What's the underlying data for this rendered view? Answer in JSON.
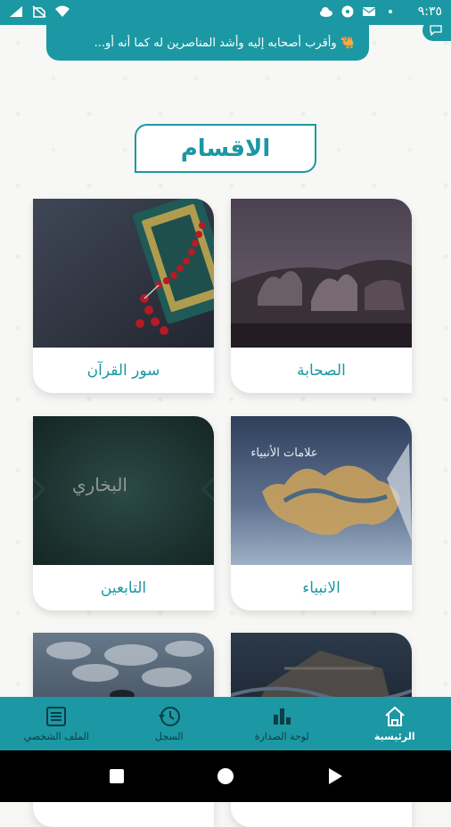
{
  "status_bar": {
    "time": "٩:٣٥"
  },
  "marquee": {
    "text": "🐫 وأقرب أصحابه إليه وأشد المناصرين له كما أنه أو..."
  },
  "section": {
    "title": "الاقسام"
  },
  "categories": [
    {
      "label": "سور القرآن",
      "image_icon": "quran-rosary-image"
    },
    {
      "label": "الصحابة",
      "image_icon": "camel-caravan-image"
    },
    {
      "label": "التابعين",
      "image_icon": "bukhari-calligraphy-image"
    },
    {
      "label": "الانبياء",
      "image_icon": "prophets-camel-art-image"
    },
    {
      "label": "",
      "image_icon": "cloudy-sky-image"
    },
    {
      "label": "",
      "image_icon": "ark-ship-image"
    }
  ],
  "prophets_image_text": "علامات الأنبياء",
  "tabiin_image_text": "البخاري",
  "bottom_nav": {
    "items": [
      {
        "label": "الملف الشخصي",
        "icon": "profile-list-icon",
        "active": false
      },
      {
        "label": "السجل",
        "icon": "history-clock-icon",
        "active": false
      },
      {
        "label": "لوحة الصدارة",
        "icon": "leaderboard-bars-icon",
        "active": false
      },
      {
        "label": "الرئيسية",
        "icon": "home-icon",
        "active": true
      }
    ]
  },
  "colors": {
    "accent": "#1b98a3",
    "background": "#f6f7f5",
    "card": "#ffffff",
    "nav_inactive": "#0d3d44"
  }
}
